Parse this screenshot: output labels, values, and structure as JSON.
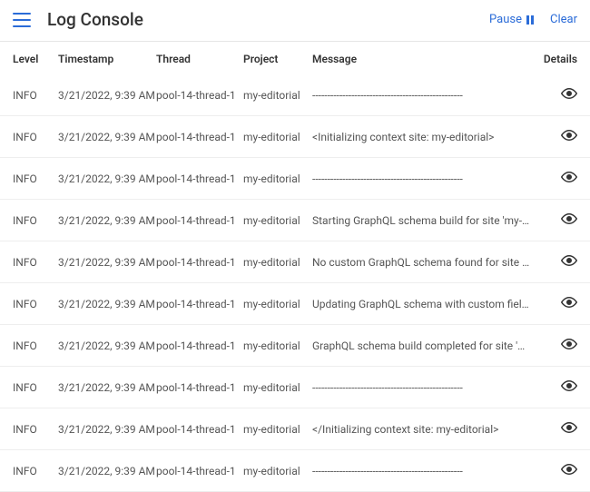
{
  "header": {
    "title": "Log Console",
    "pause_label": "Pause",
    "clear_label": "Clear"
  },
  "columns": {
    "level": "Level",
    "timestamp": "Timestamp",
    "thread": "Thread",
    "project": "Project",
    "message": "Message",
    "details": "Details"
  },
  "rows": [
    {
      "level": "INFO",
      "timestamp": "3/21/2022, 9:39 AM",
      "thread": "pool-14-thread-1",
      "project": "my-editorial",
      "message": "--------------------------------------------------"
    },
    {
      "level": "INFO",
      "timestamp": "3/21/2022, 9:39 AM",
      "thread": "pool-14-thread-1",
      "project": "my-editorial",
      "message": "<Initializing context site: my-editorial>"
    },
    {
      "level": "INFO",
      "timestamp": "3/21/2022, 9:39 AM",
      "thread": "pool-14-thread-1",
      "project": "my-editorial",
      "message": "--------------------------------------------------"
    },
    {
      "level": "INFO",
      "timestamp": "3/21/2022, 9:39 AM",
      "thread": "pool-14-thread-1",
      "project": "my-editorial",
      "message": "Starting GraphQL schema build for site 'my-editorial'"
    },
    {
      "level": "INFO",
      "timestamp": "3/21/2022, 9:39 AM",
      "thread": "pool-14-thread-1",
      "project": "my-editorial",
      "message": "No custom GraphQL schema found for site 'my-edit…"
    },
    {
      "level": "INFO",
      "timestamp": "3/21/2022, 9:39 AM",
      "thread": "pool-14-thread-1",
      "project": "my-editorial",
      "message": "Updating GraphQL schema with custom fields, fetch…"
    },
    {
      "level": "INFO",
      "timestamp": "3/21/2022, 9:39 AM",
      "thread": "pool-14-thread-1",
      "project": "my-editorial",
      "message": "GraphQL schema build completed for site 'my-edito…"
    },
    {
      "level": "INFO",
      "timestamp": "3/21/2022, 9:39 AM",
      "thread": "pool-14-thread-1",
      "project": "my-editorial",
      "message": "--------------------------------------------------"
    },
    {
      "level": "INFO",
      "timestamp": "3/21/2022, 9:39 AM",
      "thread": "pool-14-thread-1",
      "project": "my-editorial",
      "message": "</Initializing context site: my-editorial>"
    },
    {
      "level": "INFO",
      "timestamp": "3/21/2022, 9:39 AM",
      "thread": "pool-14-thread-1",
      "project": "my-editorial",
      "message": "--------------------------------------------------"
    }
  ]
}
